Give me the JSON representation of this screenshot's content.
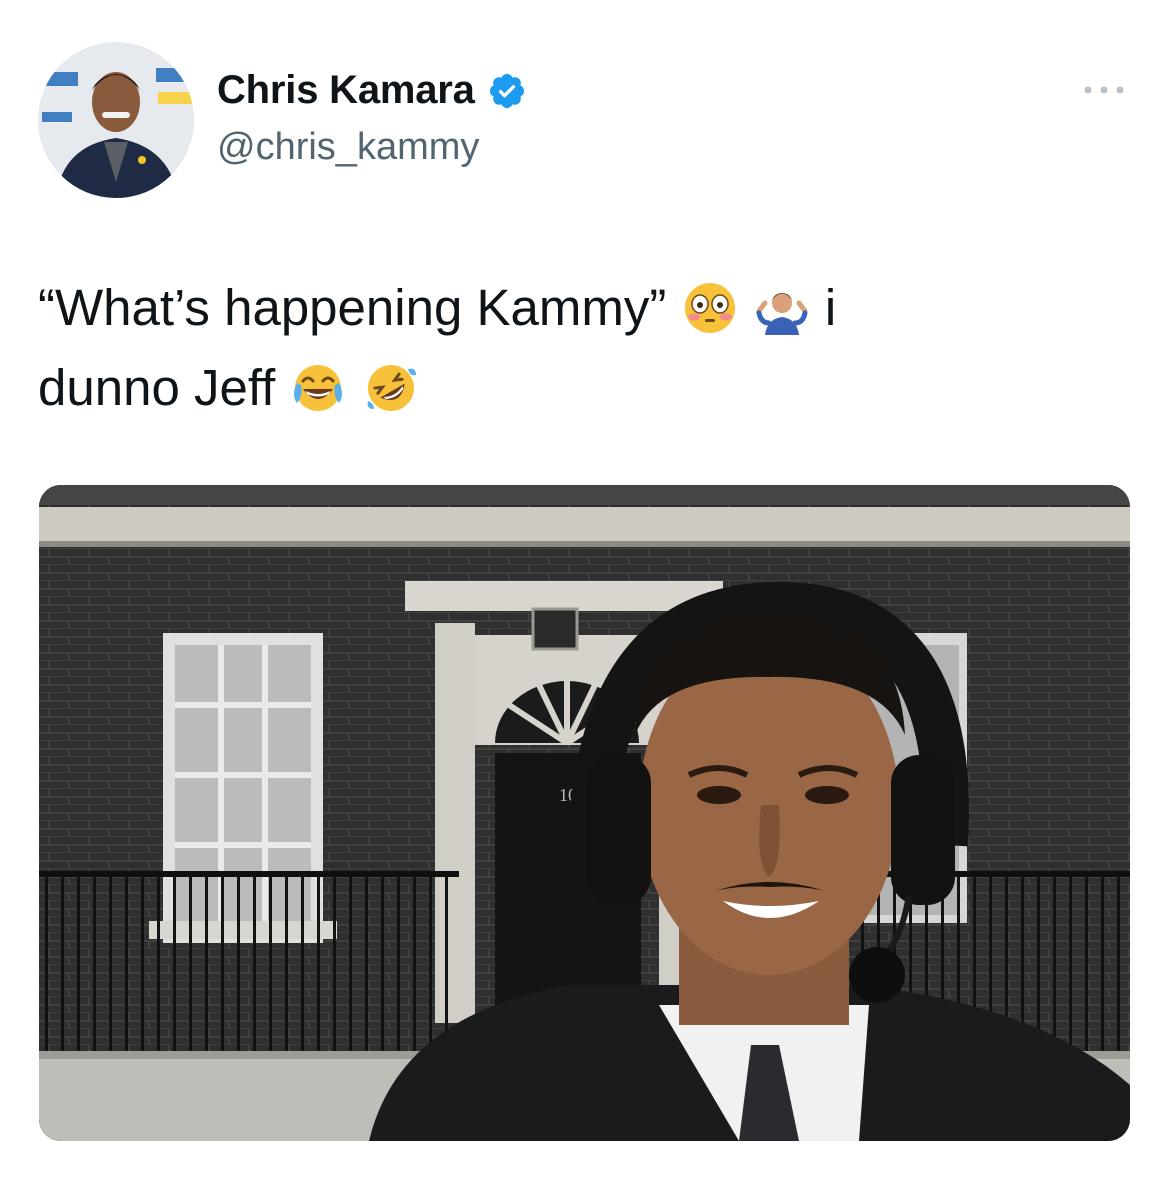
{
  "tweet": {
    "display_name": "Chris Kamara",
    "handle": "@chris_kammy",
    "verified": true,
    "text_line1": "“What’s happening Kammy”",
    "text_line1_suffix": "i",
    "text_line2": "dunno Jeff",
    "emojis": [
      "flushed-face",
      "man-shrugging",
      "face-with-tears-of-joy",
      "rolling-on-the-floor-laughing"
    ],
    "more_icon": "ellipsis-icon",
    "media_description_icon": "photo-media",
    "door_number": "10"
  },
  "colors": {
    "verified": "#1d9bf0",
    "text": "#0f1419",
    "secondary": "#536471"
  }
}
